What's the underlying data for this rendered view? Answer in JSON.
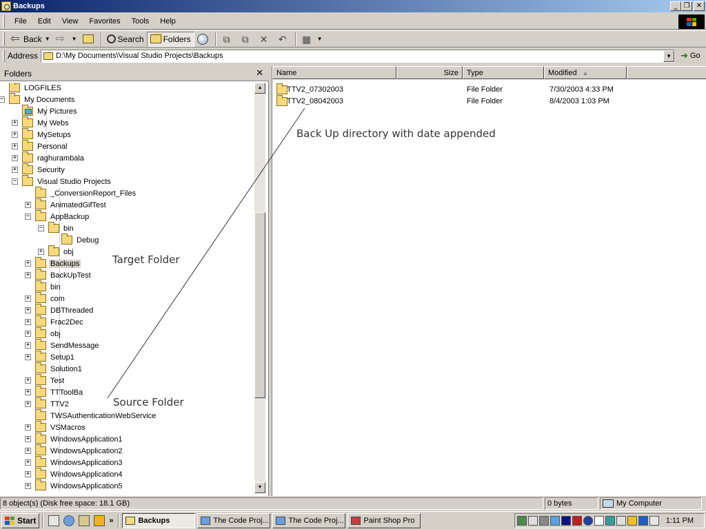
{
  "window": {
    "title": "Backups"
  },
  "caption_buttons": {
    "minimize": "_",
    "restore": "❐",
    "close": "✕"
  },
  "menu": [
    "File",
    "Edit",
    "View",
    "Favorites",
    "Tools",
    "Help"
  ],
  "toolbar": {
    "back_label": "Back",
    "search_label": "Search",
    "folders_label": "Folders"
  },
  "address": {
    "label": "Address",
    "value": "D:\\My Documents\\Visual Studio Projects\\Backups",
    "go_label": "Go"
  },
  "folders_pane": {
    "title": "Folders",
    "close_glyph": "✕",
    "tree": [
      {
        "label": "LOGFILES",
        "expander": ""
      },
      {
        "label": "My Documents",
        "expander": "−"
      },
      {
        "label": "My Pictures",
        "expander": "",
        "icon": "pictures"
      },
      {
        "label": "My Webs",
        "expander": "+"
      },
      {
        "label": "MySetups",
        "expander": "+"
      },
      {
        "label": "Personal",
        "expander": "+"
      },
      {
        "label": "raghurambala",
        "expander": "+"
      },
      {
        "label": "Security",
        "expander": "+"
      },
      {
        "label": "Visual Studio Projects",
        "expander": "−"
      },
      {
        "label": "_ConversionReport_Files",
        "expander": ""
      },
      {
        "label": "AnimatedGifTest",
        "expander": "+"
      },
      {
        "label": "AppBackup",
        "expander": "−"
      },
      {
        "label": "bin",
        "expander": "−"
      },
      {
        "label": "Debug",
        "expander": ""
      },
      {
        "label": "obj",
        "expander": "+"
      },
      {
        "label": "Backups",
        "expander": "+",
        "selected": true
      },
      {
        "label": "BackUpTest",
        "expander": "+"
      },
      {
        "label": "bin",
        "expander": ""
      },
      {
        "label": "com",
        "expander": "+"
      },
      {
        "label": "DBThreaded",
        "expander": "+"
      },
      {
        "label": "Frac2Dec",
        "expander": "+"
      },
      {
        "label": "obj",
        "expander": "+"
      },
      {
        "label": "SendMessage",
        "expander": "+"
      },
      {
        "label": "Setup1",
        "expander": "+"
      },
      {
        "label": "Solution1",
        "expander": ""
      },
      {
        "label": "Test",
        "expander": "+"
      },
      {
        "label": "TTToolBa",
        "expander": "+"
      },
      {
        "label": "TTV2",
        "expander": "+"
      },
      {
        "label": "TWSAuthenticationWebService",
        "expander": ""
      },
      {
        "label": "VSMacros",
        "expander": "+"
      },
      {
        "label": "WindowsApplication1",
        "expander": "+"
      },
      {
        "label": "WindowsApplication2",
        "expander": "+"
      },
      {
        "label": "WindowsApplication3",
        "expander": "+"
      },
      {
        "label": "WindowsApplication4",
        "expander": "+"
      },
      {
        "label": "WindowsApplication5",
        "expander": "+"
      }
    ]
  },
  "files": {
    "columns": {
      "name": "Name",
      "size": "Size",
      "type": "Type",
      "modified": "Modified"
    },
    "rows": [
      {
        "name": "TTV2_07302003",
        "size": "",
        "type": "File Folder",
        "modified": "7/30/2003 4:33 PM"
      },
      {
        "name": "TTV2_08042003",
        "size": "",
        "type": "File Folder",
        "modified": "8/4/2003 1:03 PM"
      }
    ]
  },
  "annotations": {
    "backup_dir": "Back Up directory with date appended",
    "target": "Target Folder",
    "source": "Source Folder"
  },
  "status": {
    "objects": "8 object(s) (Disk free space: 18.1 GB)",
    "size": "0 bytes",
    "zone": "My Computer"
  },
  "taskbar": {
    "start": "Start",
    "tasks": [
      "Backups",
      "The Code Proj...",
      "The Code Proj...",
      "Paint Shop Pro"
    ],
    "clock": "1:11 PM"
  },
  "colors": {
    "title_start": "#0a246a",
    "title_end": "#a6caf0",
    "folder": "#f5d97c",
    "chrome": "#d4d0c8"
  }
}
